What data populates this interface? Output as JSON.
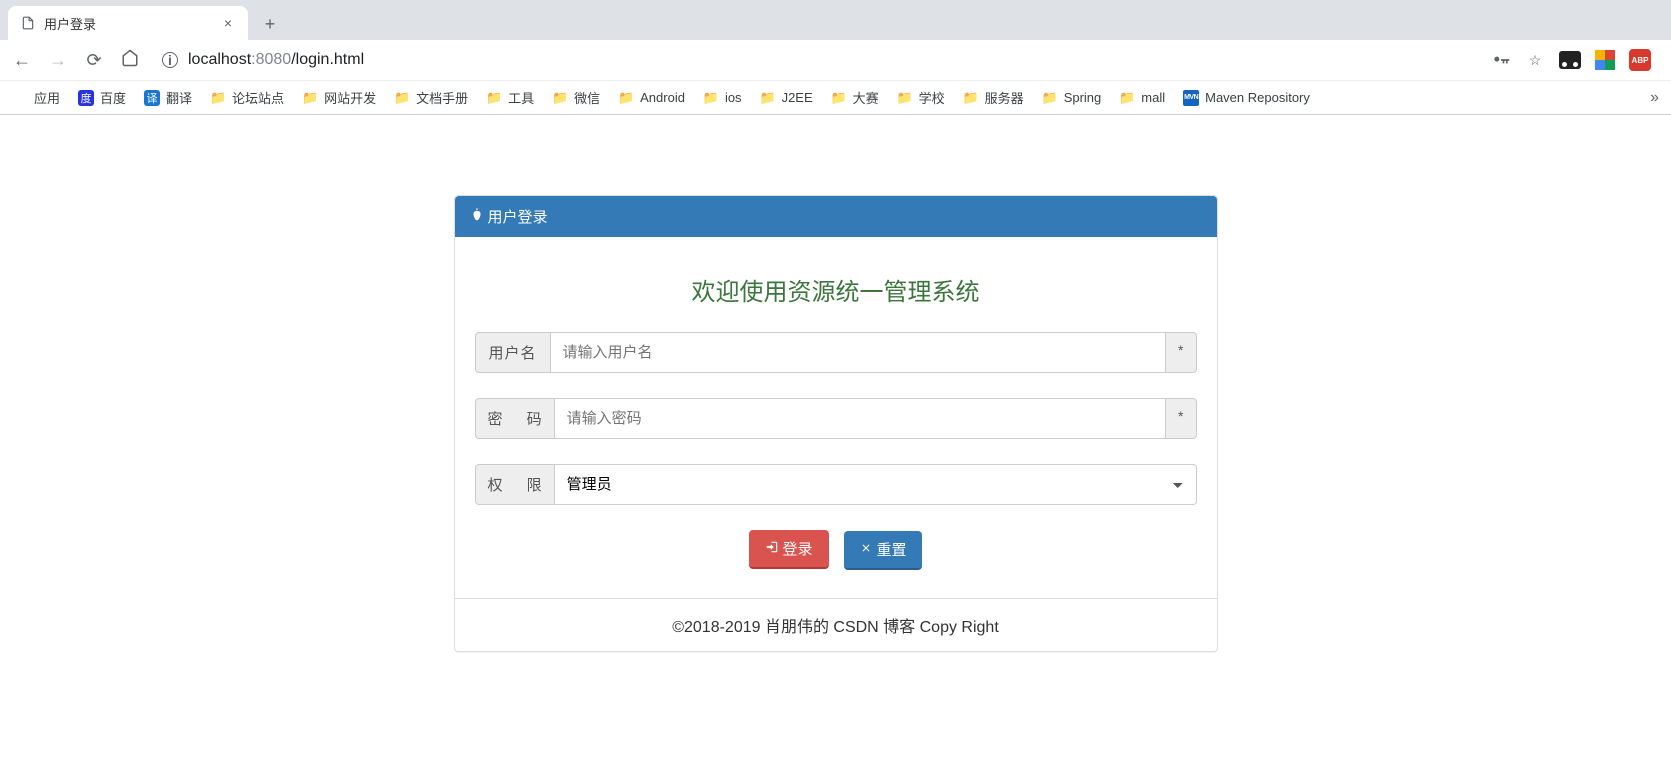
{
  "browser": {
    "tab_title": "用户登录",
    "url_host": "localhost",
    "url_port": ":8080",
    "url_path": "/login.html"
  },
  "bookmarks": [
    {
      "label": "应用",
      "icon": "apps"
    },
    {
      "label": "百度",
      "icon": "baidu"
    },
    {
      "label": "翻译",
      "icon": "translate"
    },
    {
      "label": "论坛站点",
      "icon": "folder"
    },
    {
      "label": "网站开发",
      "icon": "folder"
    },
    {
      "label": "文档手册",
      "icon": "folder"
    },
    {
      "label": "工具",
      "icon": "folder"
    },
    {
      "label": "微信",
      "icon": "folder"
    },
    {
      "label": "Android",
      "icon": "folder"
    },
    {
      "label": "ios",
      "icon": "folder"
    },
    {
      "label": "J2EE",
      "icon": "folder"
    },
    {
      "label": "大赛",
      "icon": "folder"
    },
    {
      "label": "学校",
      "icon": "folder"
    },
    {
      "label": "服务器",
      "icon": "folder"
    },
    {
      "label": "Spring",
      "icon": "folder"
    },
    {
      "label": "mall",
      "icon": "folder"
    },
    {
      "label": "Maven Repository",
      "icon": "mvn"
    }
  ],
  "panel": {
    "heading": "用户登录",
    "welcome": "欢迎使用资源统一管理系统",
    "username_label": "用户名",
    "username_placeholder": "请输入用户名",
    "password_label": "密 码",
    "password_placeholder": "请输入密码",
    "role_label": "权 限",
    "role_selected": "管理员",
    "required_mark": "*",
    "login_btn": "登录",
    "reset_btn": "重置",
    "footer": "©2018-2019 肖朋伟的 CSDN 博客 Copy Right"
  }
}
